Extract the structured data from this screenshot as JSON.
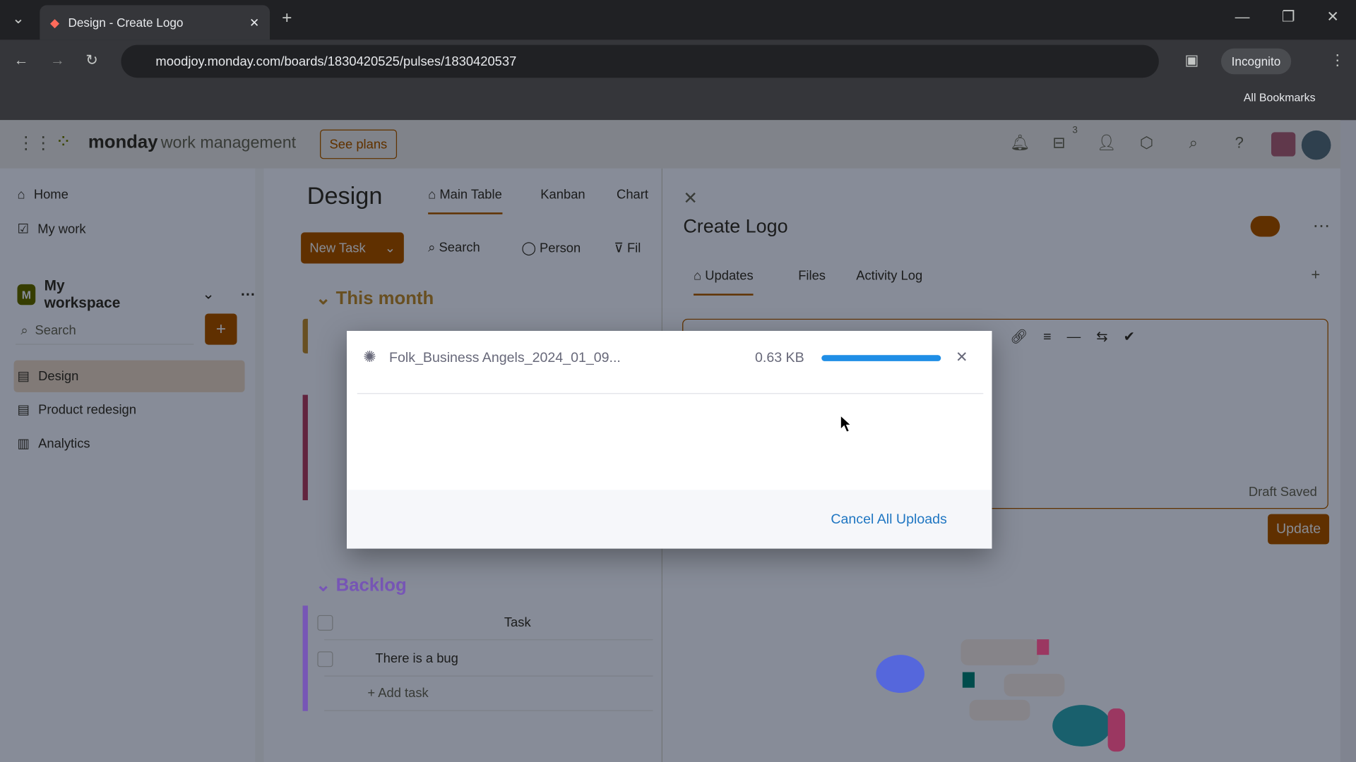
{
  "browser": {
    "tab_title": "Design - Create Logo",
    "url": "moodjoy.monday.com/boards/1830420525/pulses/1830420537",
    "incognito_label": "Incognito",
    "bookmarks_label": "All Bookmarks"
  },
  "header": {
    "brand": "monday",
    "product": "work management",
    "see_plans": "See plans",
    "inbox_count": "3"
  },
  "sidebar": {
    "home": "Home",
    "my_work": "My work",
    "workspace": "My workspace",
    "workspace_initial": "M",
    "search_placeholder": "Search",
    "boards": [
      {
        "label": "Design"
      },
      {
        "label": "Product redesign"
      },
      {
        "label": "Analytics"
      }
    ]
  },
  "board": {
    "title": "Design",
    "views": [
      "Main Table",
      "Kanban",
      "Chart"
    ],
    "new_task": "New Task",
    "search": "Search",
    "person": "Person",
    "filter": "Fil",
    "groups": [
      {
        "name": "This month",
        "color": "#579bfc"
      },
      {
        "name": "Backlog",
        "color": "#9cd326"
      }
    ],
    "column_task": "Task",
    "task_row": "There is a bug",
    "add_task": "+ Add task"
  },
  "panel": {
    "title": "Create Logo",
    "tabs": [
      "Updates",
      "Files",
      "Activity Log"
    ],
    "draft_saved": "Draft Saved",
    "update_button": "Update"
  },
  "upload_dialog": {
    "file_name": "Folk_Business Angels_2024_01_09...",
    "file_size": "0.63 KB",
    "progress_percent": 100,
    "cancel_all": "Cancel All Uploads",
    "accent": "#1f8ee6"
  }
}
